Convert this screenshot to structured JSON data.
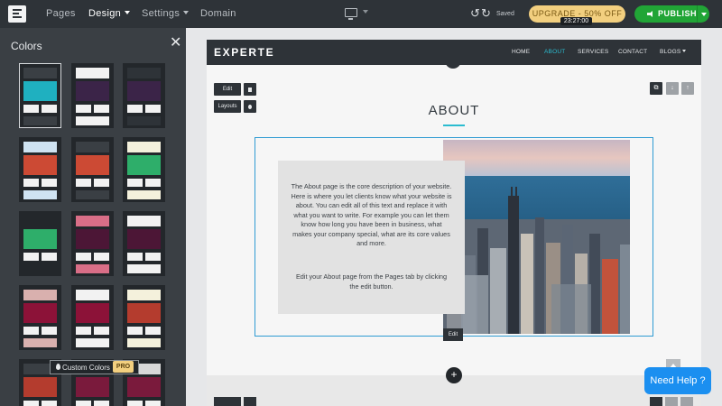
{
  "topbar": {
    "nav": [
      "Pages",
      "Design",
      "Settings",
      "Domain"
    ],
    "active_nav": "Design",
    "saved_label": "Saved",
    "upgrade_label": "UPGRADE - 50% OFF",
    "timer": "23:27:00",
    "publish_label": "PUBLISH",
    "icons": [
      "menu-logo-icon",
      "desktop-icon",
      "undo-icon",
      "redo-icon",
      "megaphone-icon"
    ]
  },
  "panel": {
    "title": "Colors",
    "close_glyph": "✕",
    "custom_label": "Custom Colors",
    "pro_badge": "PRO",
    "schemes": [
      {
        "top": "#3a3f44",
        "main": "#1fb0c0",
        "sq": "#f2f2f2",
        "bottom": "#3a3f44"
      },
      {
        "top": "#f2f2f2",
        "main": "#3b2448",
        "sq": "#f2f2f2",
        "bottom": "#f2f2f2"
      },
      {
        "top": "#2e3338",
        "main": "#3b2448",
        "sq": "#f2f2f2",
        "bottom": "#2e3338"
      },
      {
        "top": "#cfe3f2",
        "main": "#cc4a34",
        "sq": "#f2f2f2",
        "bottom": "#cfe3f2"
      },
      {
        "top": "#3a3f44",
        "main": "#cc4a34",
        "sq": "#f2f2f2",
        "bottom": "#3a3f44"
      },
      {
        "top": "#f4f1dc",
        "main": "#2eae6a",
        "sq": "#f2f2f2",
        "bottom": "#f4f1dc"
      },
      {
        "top": "#23272b",
        "main": "#2eae6a",
        "sq": "#f2f2f2",
        "bottom": "#23272b"
      },
      {
        "top": "#d96e87",
        "main": "#4c1636",
        "sq": "#f2f2f2",
        "bottom": "#d96e87"
      },
      {
        "top": "#f2f2f2",
        "main": "#4c1636",
        "sq": "#f2f2f2",
        "bottom": "#f2f2f2"
      },
      {
        "top": "#d9b0ae",
        "main": "#8c1238",
        "sq": "#f2f2f2",
        "bottom": "#d9b0ae"
      },
      {
        "top": "#f2f2f2",
        "main": "#8c1238",
        "sq": "#f2f2f2",
        "bottom": "#f2f2f2"
      },
      {
        "top": "#f4f1dc",
        "main": "#b43c2e",
        "sq": "#f2f2f2",
        "bottom": "#f4f1dc"
      },
      {
        "top": "#3a3f44",
        "main": "#b43c2e",
        "sq": "#f2f2f2",
        "bottom": "#3a3f44"
      },
      {
        "top": "#f2eee6",
        "main": "#7a1a3c",
        "sq": "#f2f2f2",
        "bottom": "#f2eee6"
      },
      {
        "top": "#d8d8d8",
        "main": "#7a1a3c",
        "sq": "#f2f2f2",
        "bottom": "#d8d8d8"
      }
    ]
  },
  "site": {
    "brand": "EXPERTE",
    "nav": [
      "HOME",
      "ABOUT",
      "SERVICES",
      "CONTACT",
      "BLOGS"
    ],
    "current_nav": "ABOUT",
    "edit_label": "Edit",
    "layouts_label": "Layouts",
    "section_title": "ABOUT",
    "paragraph1": "The About page is the core description of your website. Here is where you let clients know what your website is about. You can edit all of this text and replace it with what you want to write. For example you can let them know how long you have been in business, what makes your company special, what are its core values and more.",
    "paragraph2": "Edit your About page from the Pages tab by clicking the edit button.",
    "image_edit_label": "Edit",
    "add_glyph": "+"
  },
  "help_label": "Need Help ?",
  "colors": {
    "accent": "#2bbcd0",
    "publish": "#21a536",
    "upgrade": "#f2cf7f",
    "help": "#1b8ff0"
  }
}
